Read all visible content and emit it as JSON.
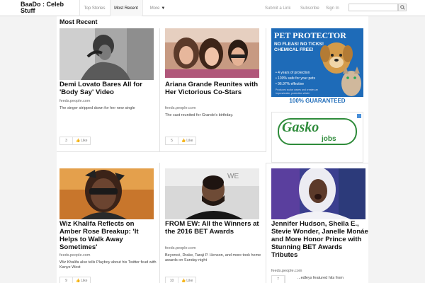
{
  "header": {
    "brand": "BaaDo : Celeb Stuff",
    "tabs": [
      {
        "label": "Top Stories"
      },
      {
        "label": "Most Recent"
      },
      {
        "label": "More"
      }
    ],
    "links": {
      "submit": "Submit a Link",
      "subscribe": "Subscribe",
      "signin": "Sign In"
    },
    "search": {
      "placeholder": "",
      "value": ""
    }
  },
  "main": {
    "section_title": "Most Recent",
    "cards": [
      {
        "title": "Demi Lovato Bares All for 'Body Say' Video",
        "source": "feeds.people.com",
        "desc": "The singer stripped down for her new single",
        "likes": "3",
        "like_label": "Like"
      },
      {
        "title": "Ariana Grande Reunites with Her Victorious Co-Stars",
        "source": "feeds.people.com",
        "desc": "The cast reunited for Grande's birthday.",
        "likes": "5",
        "like_label": "Like"
      },
      {
        "title": "Wiz Khalifa Reflects on Amber Rose Breakup: 'It Helps to Walk Away Sometimes'",
        "source": "feeds.people.com",
        "desc": "Wiz Khalifa also tells Playboy about his Twitter feud with Kanye West",
        "likes": "9",
        "like_label": "Like"
      },
      {
        "title": "FROM EW: All the Winners at the 2016 BET Awards",
        "source": "feeds.people.com",
        "desc": "Beyoncé, Drake, Taraji P. Henson, and more took home awards on Sunday night",
        "likes": "10",
        "like_label": "Like"
      },
      {
        "title": "Jennifer Hudson, Sheila E., Stevie Wonder, Janelle Monáe and More Honor Prince with Stunning BET Awards Tributes",
        "source": "feeds.people.com",
        "desc": "...edleys featured hits from",
        "likes": "7",
        "like_label": "Like"
      }
    ]
  },
  "ads": {
    "pet": {
      "title": "PET PROTECTOR",
      "sub1": "NO FLEAS! NO TICKS!",
      "sub2": "CHEMICAL FREE!",
      "b1": "• 4 years of protection",
      "b2": "• 100% safe for your pets",
      "b3": "• 96.97% effective",
      "small": "Produces scalar waves and creates an impenetrable, protective shield.",
      "guarantee": "100% GUARANTEED"
    },
    "jobs": {
      "brand": "Gasko",
      "sub": "jobs"
    }
  },
  "colors": {
    "accent": "#2a6fb8",
    "pet_bg": "#1e6bb8",
    "jobs_green": "#2e8b3a"
  }
}
